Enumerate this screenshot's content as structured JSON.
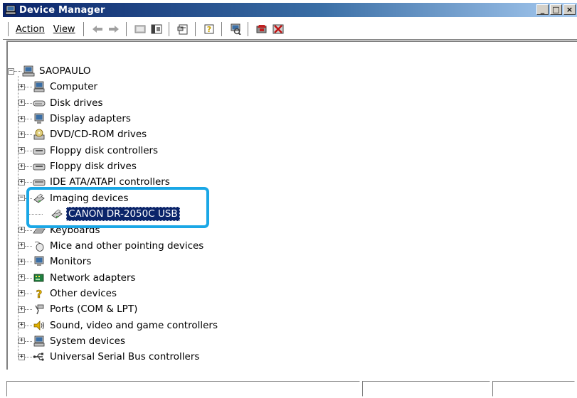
{
  "window": {
    "title": "Device Manager"
  },
  "caption_buttons": {
    "minimize": "_",
    "maximize": "□",
    "close": "×"
  },
  "menu": {
    "action": "Action",
    "view": "View"
  },
  "toolbar": {
    "buttons": [
      "back-icon",
      "forward-icon",
      "up-icon",
      "show-hide-tree-icon",
      "properties-icon",
      "help-icon",
      "scan-hardware-icon",
      "update-driver-icon",
      "uninstall-icon"
    ]
  },
  "tree": {
    "root": "SAOPAULO",
    "items": [
      {
        "label": "Computer",
        "icon": "computer-icon",
        "expander": "+"
      },
      {
        "label": "Disk drives",
        "icon": "disk-drive-icon",
        "expander": "+"
      },
      {
        "label": "Display adapters",
        "icon": "display-adapter-icon",
        "expander": "+"
      },
      {
        "label": "DVD/CD-ROM drives",
        "icon": "dvd-drive-icon",
        "expander": "+"
      },
      {
        "label": "Floppy disk controllers",
        "icon": "floppy-controller-icon",
        "expander": "+"
      },
      {
        "label": "Floppy disk drives",
        "icon": "floppy-drive-icon",
        "expander": "+"
      },
      {
        "label": "IDE ATA/ATAPI controllers",
        "icon": "ide-controller-icon",
        "expander": "+"
      },
      {
        "label": "Imaging devices",
        "icon": "scanner-icon",
        "expander": "−"
      },
      {
        "label": "Keyboards",
        "icon": "keyboard-icon",
        "expander": "+"
      },
      {
        "label": "Mice and other pointing devices",
        "icon": "mouse-icon",
        "expander": "+"
      },
      {
        "label": "Monitors",
        "icon": "monitor-icon",
        "expander": "+"
      },
      {
        "label": "Network adapters",
        "icon": "network-adapter-icon",
        "expander": "+"
      },
      {
        "label": "Other devices",
        "icon": "question-mark-icon",
        "expander": "+"
      },
      {
        "label": "Ports (COM & LPT)",
        "icon": "port-icon",
        "expander": "+"
      },
      {
        "label": "Sound, video and game controllers",
        "icon": "speaker-icon",
        "expander": "+"
      },
      {
        "label": "System devices",
        "icon": "system-device-icon",
        "expander": "+"
      },
      {
        "label": "Universal Serial Bus controllers",
        "icon": "usb-icon",
        "expander": "+"
      }
    ],
    "child": {
      "label": "CANON DR-2050C USB",
      "icon": "scanner-icon",
      "parent": "Imaging devices"
    }
  },
  "colors": {
    "highlight_box": "#1aa7e6",
    "selection": "#0a246a",
    "titlebar": "#0a246a"
  }
}
